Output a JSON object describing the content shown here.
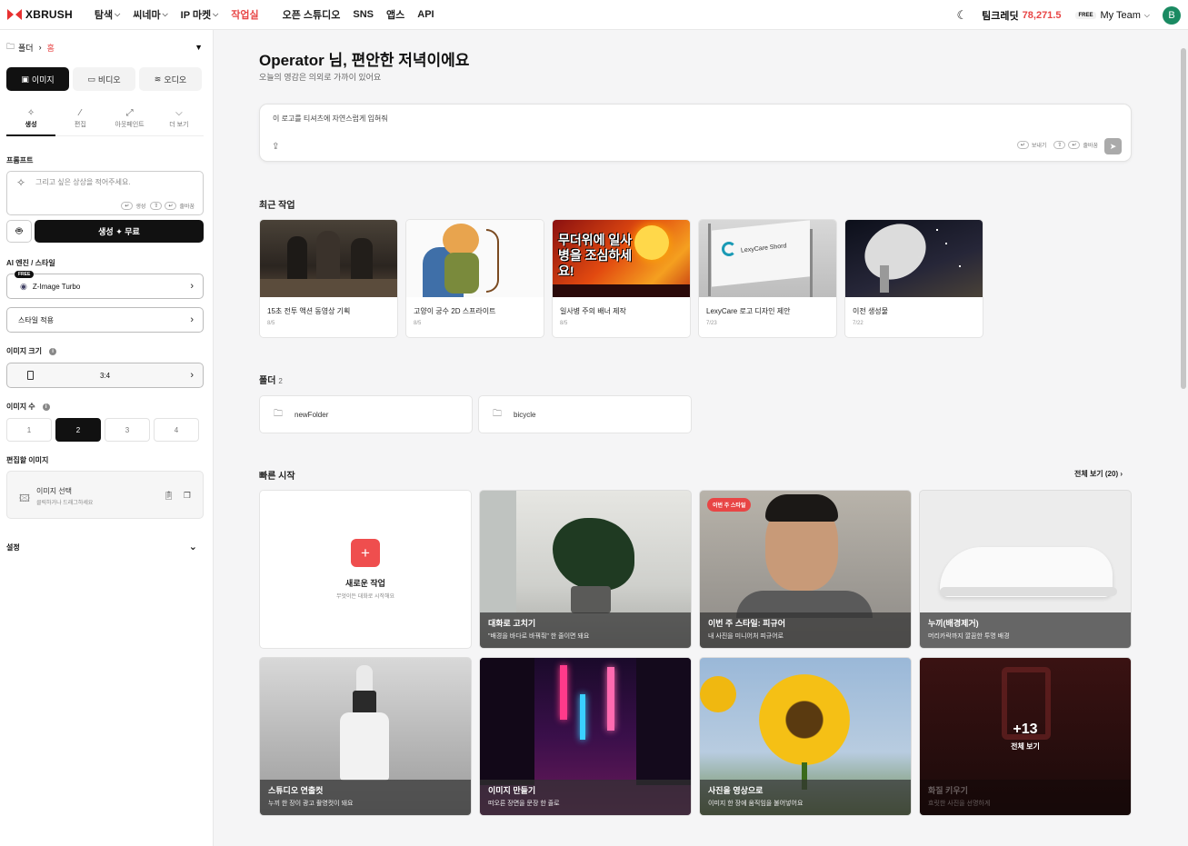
{
  "brand": "XBRUSH",
  "nav": [
    {
      "label": "탐색",
      "chev": true
    },
    {
      "label": "씨네마",
      "chev": true
    },
    {
      "label": "IP 마켓",
      "chev": true
    },
    {
      "label": "작업실",
      "chev": false
    },
    {
      "label": "오픈 스튜디오",
      "chev": false
    },
    {
      "label": "SNS",
      "chev": false
    },
    {
      "label": "앱스",
      "chev": false
    },
    {
      "label": "API",
      "chev": false
    }
  ],
  "topright": {
    "ticket_label": "팀크레딧",
    "credits": "78,271.5",
    "free": "FREE",
    "team": "My Team",
    "avatar": "B"
  },
  "sidebar": {
    "folder": "폴더",
    "home": "홈",
    "media_tabs": [
      {
        "label": "이미지"
      },
      {
        "label": "비디오"
      },
      {
        "label": "오디오"
      }
    ],
    "sub_tabs": [
      {
        "label": "생성"
      },
      {
        "label": "편집"
      },
      {
        "label": "아웃페인트"
      },
      {
        "label": "더 보기"
      }
    ],
    "prompt_label": "프롬프트",
    "prompt_placeholder": "그리고 싶은 상상을 적어주세요.",
    "hint_gen": "생성",
    "hint_newline": "줄바꿈",
    "generate": "생성 ✦ 무료",
    "engine_label": "AI 엔진 / 스타일",
    "engine_badge": "FREE",
    "engine": "Z-Image Turbo",
    "style": "스타일 적용",
    "size_label": "이미지 크기",
    "size": "3:4",
    "count_label": "이미지 수",
    "counts": [
      "1",
      "2",
      "3",
      "4"
    ],
    "edit_label": "편집할 이미지",
    "edit_title": "이미지 선택",
    "edit_sub": "클릭하거나 드래그하세요",
    "settings": "설정"
  },
  "main": {
    "greeting": "Operator 님, 편안한 저녁이에요",
    "sub": "오늘의 영감은 의외로 가까이 있어요",
    "composer_text": "이 로고를 티셔츠에 자연스럽게 입혀줘",
    "hint_send": "보내기",
    "hint_newline": "줄바꿈",
    "recent_title": "최근 작업",
    "recent": [
      {
        "title": "15초 전투 액션 동영상 기획",
        "date": "8/5"
      },
      {
        "title": "고양이 궁수 2D 스프라이트",
        "date": "8/5"
      },
      {
        "title": "일사병 주의 배너 제작",
        "date": "8/5"
      },
      {
        "title": "LexyCare 로고 디자인 제안",
        "date": "7/23"
      },
      {
        "title": "이전 생성물",
        "date": "7/22"
      }
    ],
    "banner_text": "무더위에 일사병을 조심하세요!",
    "flag_text": "LexyCare Shord",
    "folders_title": "폴더",
    "folders_count": "2",
    "folders": [
      {
        "name": "newFolder"
      },
      {
        "name": "bicycle"
      }
    ],
    "quick_title": "빠른 시작",
    "see_all": "전체 보기 (20) ›",
    "new_work": {
      "title": "새로운 작업",
      "sub": "무엇이든 대화로 시작해요"
    },
    "quick": [
      {
        "title": "대화로 고치기",
        "sub": "\"배경을 바다로 바꿔줘\" 한 줄이면 돼요"
      },
      {
        "title": "이번 주 스타일: 피규어",
        "sub": "내 사진을 미니어처 피규어로",
        "pill": "이번 주 스타일"
      },
      {
        "title": "누끼(배경제거)",
        "sub": "머리카락까지 깔끔한 투명 배경"
      },
      {
        "title": "스튜디오 연출컷",
        "sub": "누끼 한 장이 광고 촬영컷이 돼요"
      },
      {
        "title": "이미지 만들기",
        "sub": "떠오른 장면을 문장 한 줄로"
      },
      {
        "title": "사진을 영상으로",
        "sub": "이미지 한 장에 움직임을 불어넣어요"
      }
    ],
    "more": {
      "count": "+13",
      "label": "전체 보기",
      "title": "화질 키우기",
      "sub": "흐릿한 사진을 선명하게"
    }
  }
}
